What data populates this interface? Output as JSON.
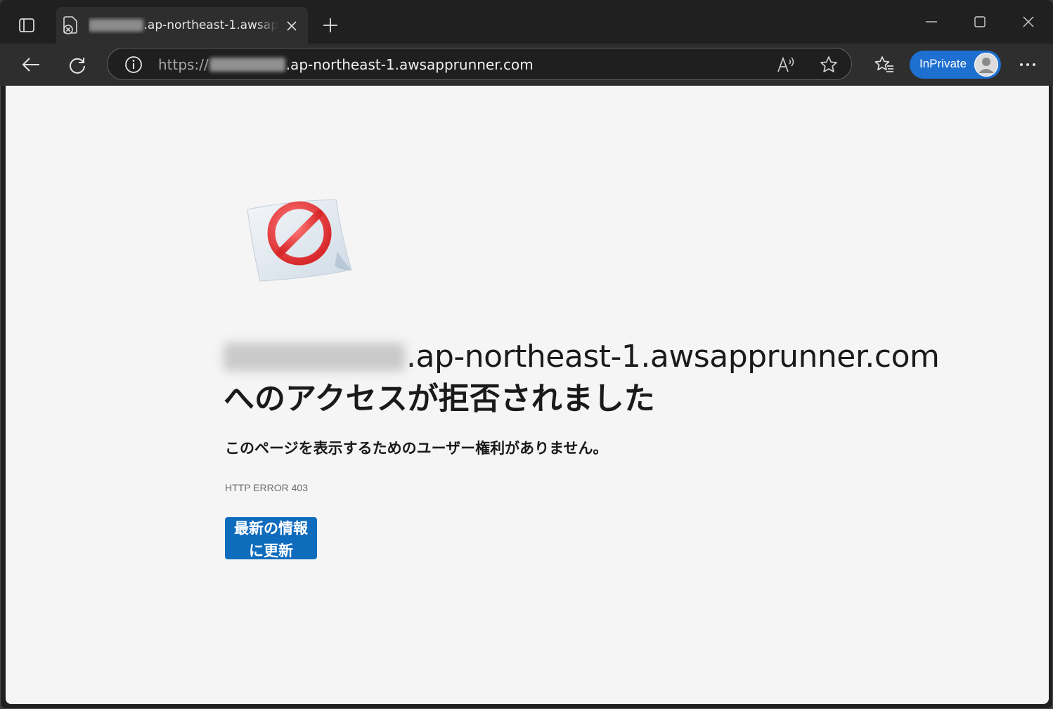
{
  "browser": {
    "tab": {
      "title_visible": ".ap-northeast-1.awsap"
    },
    "address_bar": {
      "scheme": "https://",
      "host_suffix": ".ap-northeast-1.awsapprunner.com"
    },
    "profile": {
      "label": "InPrivate"
    },
    "icons": {
      "tab_actions": "tab-actions-icon",
      "favicon": "page-error-icon",
      "close_tab": "close-icon",
      "new_tab": "plus-icon",
      "minimize": "minimize-icon",
      "maximize": "maximize-icon",
      "close_window": "close-icon",
      "back": "back-arrow-icon",
      "refresh": "refresh-icon",
      "site_info": "info-icon",
      "read_aloud": "read-aloud-icon",
      "favorite": "star-icon",
      "favorites": "favorites-icon",
      "more": "more-icon"
    },
    "accent_color": "#1d6fd0"
  },
  "page": {
    "heading_host": ".ap-northeast-1.awsapprunner.com",
    "heading_message": "へのアクセスが拒否されました",
    "subtext": "このページを表示するためのユーザー権利がありません。",
    "error_code": "HTTP ERROR 403",
    "refresh_button_label": "最新の情報に更新",
    "illustration": "access-denied-illustration",
    "button_color": "#0f6cbd"
  }
}
